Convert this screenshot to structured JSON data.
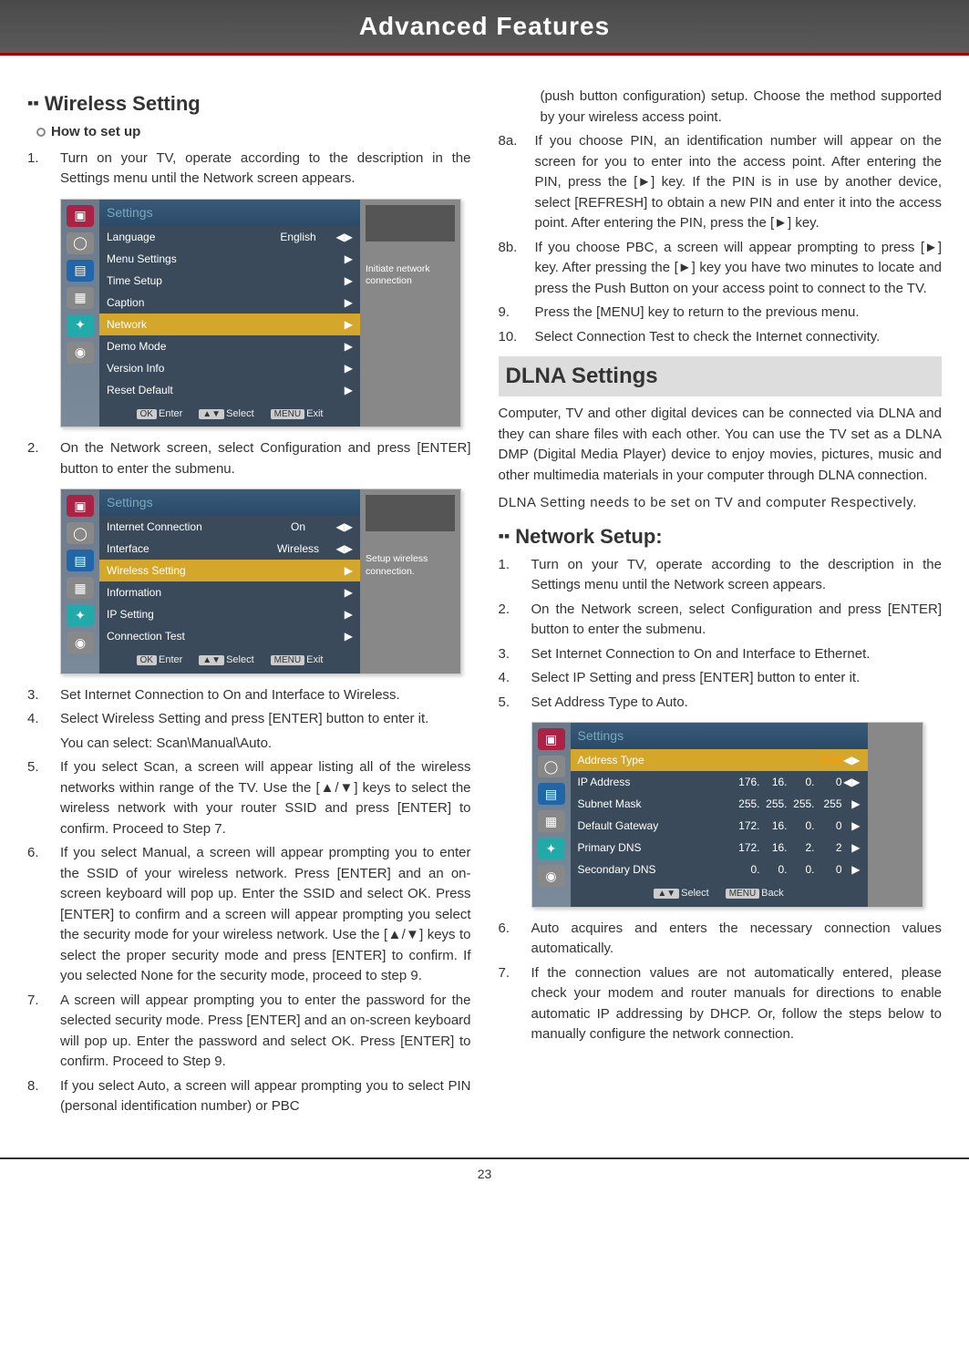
{
  "header": {
    "title": "Advanced Features"
  },
  "page_number": "23",
  "left": {
    "section_title": "Wireless Setting",
    "howto": "How to set up",
    "steps_a": {
      "n1": "1.",
      "t1": "Turn on your TV, operate according to the description in the Settings menu until the Network screen appears."
    },
    "panel1": {
      "title": "Settings",
      "rows": [
        {
          "label": "Language",
          "val": "English",
          "arrow": "◀▶",
          "hl": false
        },
        {
          "label": "Menu Settings",
          "val": "",
          "arrow": "▶",
          "hl": false
        },
        {
          "label": "Time Setup",
          "val": "",
          "arrow": "▶",
          "hl": false
        },
        {
          "label": "Caption",
          "val": "",
          "arrow": "▶",
          "hl": false
        },
        {
          "label": "Network",
          "val": "",
          "arrow": "▶",
          "hl": true
        },
        {
          "label": "Demo Mode",
          "val": "",
          "arrow": "▶",
          "hl": false
        },
        {
          "label": "Version Info",
          "val": "",
          "arrow": "▶",
          "hl": false
        },
        {
          "label": "Reset Default",
          "val": "",
          "arrow": "▶",
          "hl": false
        }
      ],
      "hint_ok": "OK",
      "hint_enter": "Enter",
      "hint_sel": "▲▼",
      "hint_select": "Select",
      "hint_menu": "MENU",
      "hint_exit": "Exit",
      "side": "Initiate network connection"
    },
    "steps_b": {
      "n2": "2.",
      "t2": "On the Network screen, select Configuration and press [ENTER] button to enter the submenu."
    },
    "panel2": {
      "title": "Settings",
      "rows": [
        {
          "label": "Internet Connection",
          "val": "On",
          "arrow": "◀▶",
          "hl": false
        },
        {
          "label": "Interface",
          "val": "Wireless",
          "arrow": "◀▶",
          "hl": false
        },
        {
          "label": "Wireless Setting",
          "val": "",
          "arrow": "▶",
          "hl": true
        },
        {
          "label": "Information",
          "val": "",
          "arrow": "▶",
          "hl": false
        },
        {
          "label": "IP Setting",
          "val": "",
          "arrow": "▶",
          "hl": false
        },
        {
          "label": "Connection Test",
          "val": "",
          "arrow": "▶",
          "hl": false
        }
      ],
      "side": "Setup wireless connection."
    },
    "steps_c": [
      {
        "n": "3.",
        "t": "Set Internet Connection to On and Interface to Wireless."
      },
      {
        "n": "4.",
        "t": "Select Wireless Setting and press [ENTER] button to enter it."
      },
      {
        "sub": "You can select: Scan\\Manual\\Auto."
      },
      {
        "n": "5.",
        "t": "If you select Scan, a screen will appear listing all of the wireless networks within range of the TV. Use the [▲/▼] keys to select the wireless network with your router SSID and press [ENTER] to confirm. Proceed to Step 7."
      },
      {
        "n": "6.",
        "t": "If you select Manual, a screen will appear prompting you to enter the SSID of your wireless network. Press [ENTER] and an on-screen keyboard will pop up.  Enter the SSID and select OK. Press [ENTER] to confirm and a screen will appear prompting you select the security mode for your wireless network. Use the [▲/▼] keys to select the proper security mode and press [ENTER] to confirm. If you selected None for the security mode, proceed to step 9."
      },
      {
        "n": "7.",
        "t": "A screen will appear prompting you to enter the password for the selected security mode. Press [ENTER] and an on-screen keyboard will pop up. Enter the password and select OK. Press [ENTER] to confirm. Proceed to Step 9."
      },
      {
        "n": "8.",
        "t": "If you select Auto, a screen will appear prompting you to select PIN (personal identification number) or PBC"
      }
    ]
  },
  "right": {
    "top_paras": [
      {
        "n": "",
        "t": "(push button configuration) setup. Choose the method supported by your wireless access point."
      },
      {
        "n": "8a.",
        "t": "If you choose PIN, an identification number will appear on the screen for you to enter into the access point. After entering the PIN, press the [►] key. If the PIN is in use by another device, select [REFRESH] to obtain a new PIN and enter it into the access point. After entering the PIN, press the [►] key."
      },
      {
        "n": "8b.",
        "t": "If you choose PBC, a screen will appear prompting to press [►] key. After pressing the [►] key you have two minutes to locate and press the Push Button on your access point to connect to the TV."
      },
      {
        "n": "9.",
        "t": "Press the [MENU] key to return to the previous menu."
      },
      {
        "n": "10.",
        "t": "Select Connection Test to check the Internet connectivity."
      }
    ],
    "dlna_title": "DLNA Settings",
    "dlna_p1": "Computer, TV and other digital devices can be connected via DLNA and they can share files with each other. You can use the TV set as a DLNA DMP (Digital Media Player) device to enjoy movies, pictures, music and other multimedia materials in your computer through DLNA connection.",
    "dlna_p2": "DLNA Setting needs to be set on TV and computer Respectively.",
    "net_title": "Network Setup:",
    "net_steps": [
      {
        "n": "1.",
        "t": "Turn on your TV, operate according to the description in the Settings menu until the Network screen appears."
      },
      {
        "n": "2.",
        "t": "On the Network screen, select Configuration and press [ENTER] button to enter the submenu."
      },
      {
        "n": "3.",
        "t": "Set Internet Connection to On and Interface to Ethernet."
      },
      {
        "n": "4.",
        "t": "Select IP Setting and press [ENTER] button to enter it."
      },
      {
        "n": "5.",
        "t": "Set Address Type to Auto."
      }
    ],
    "panel3": {
      "title": "Settings",
      "rows": [
        {
          "label": "Address Type",
          "ip": [
            "",
            "",
            "",
            "Auto"
          ],
          "arrow": "◀▶",
          "hl": true
        },
        {
          "label": "IP Address",
          "ip": [
            "176.",
            "16.",
            "0.",
            "0"
          ],
          "arrow": "◀▶",
          "hl": false
        },
        {
          "label": "Subnet Mask",
          "ip": [
            "255.",
            "255.",
            "255.",
            "255"
          ],
          "arrow": "▶",
          "hl": false
        },
        {
          "label": "Default Gateway",
          "ip": [
            "172.",
            "16.",
            "0.",
            "0"
          ],
          "arrow": "▶",
          "hl": false
        },
        {
          "label": "Primary DNS",
          "ip": [
            "172.",
            "16.",
            "2.",
            "2"
          ],
          "arrow": "▶",
          "hl": false
        },
        {
          "label": "Secondary DNS",
          "ip": [
            "0.",
            "0.",
            "0.",
            "0"
          ],
          "arrow": "▶",
          "hl": false
        }
      ],
      "hint_sel": "▲▼",
      "hint_select": "Select",
      "hint_menu": "MENU",
      "hint_back": "Back"
    },
    "net_steps2": [
      {
        "n": "6.",
        "t": "Auto acquires and enters the necessary connection values automatically."
      },
      {
        "n": "7.",
        "t": "If the connection values are not automatically entered, please check your modem and router manuals for directions to enable automatic IP addressing by DHCP.  Or, follow the steps below to manually configure the network connection."
      }
    ]
  }
}
